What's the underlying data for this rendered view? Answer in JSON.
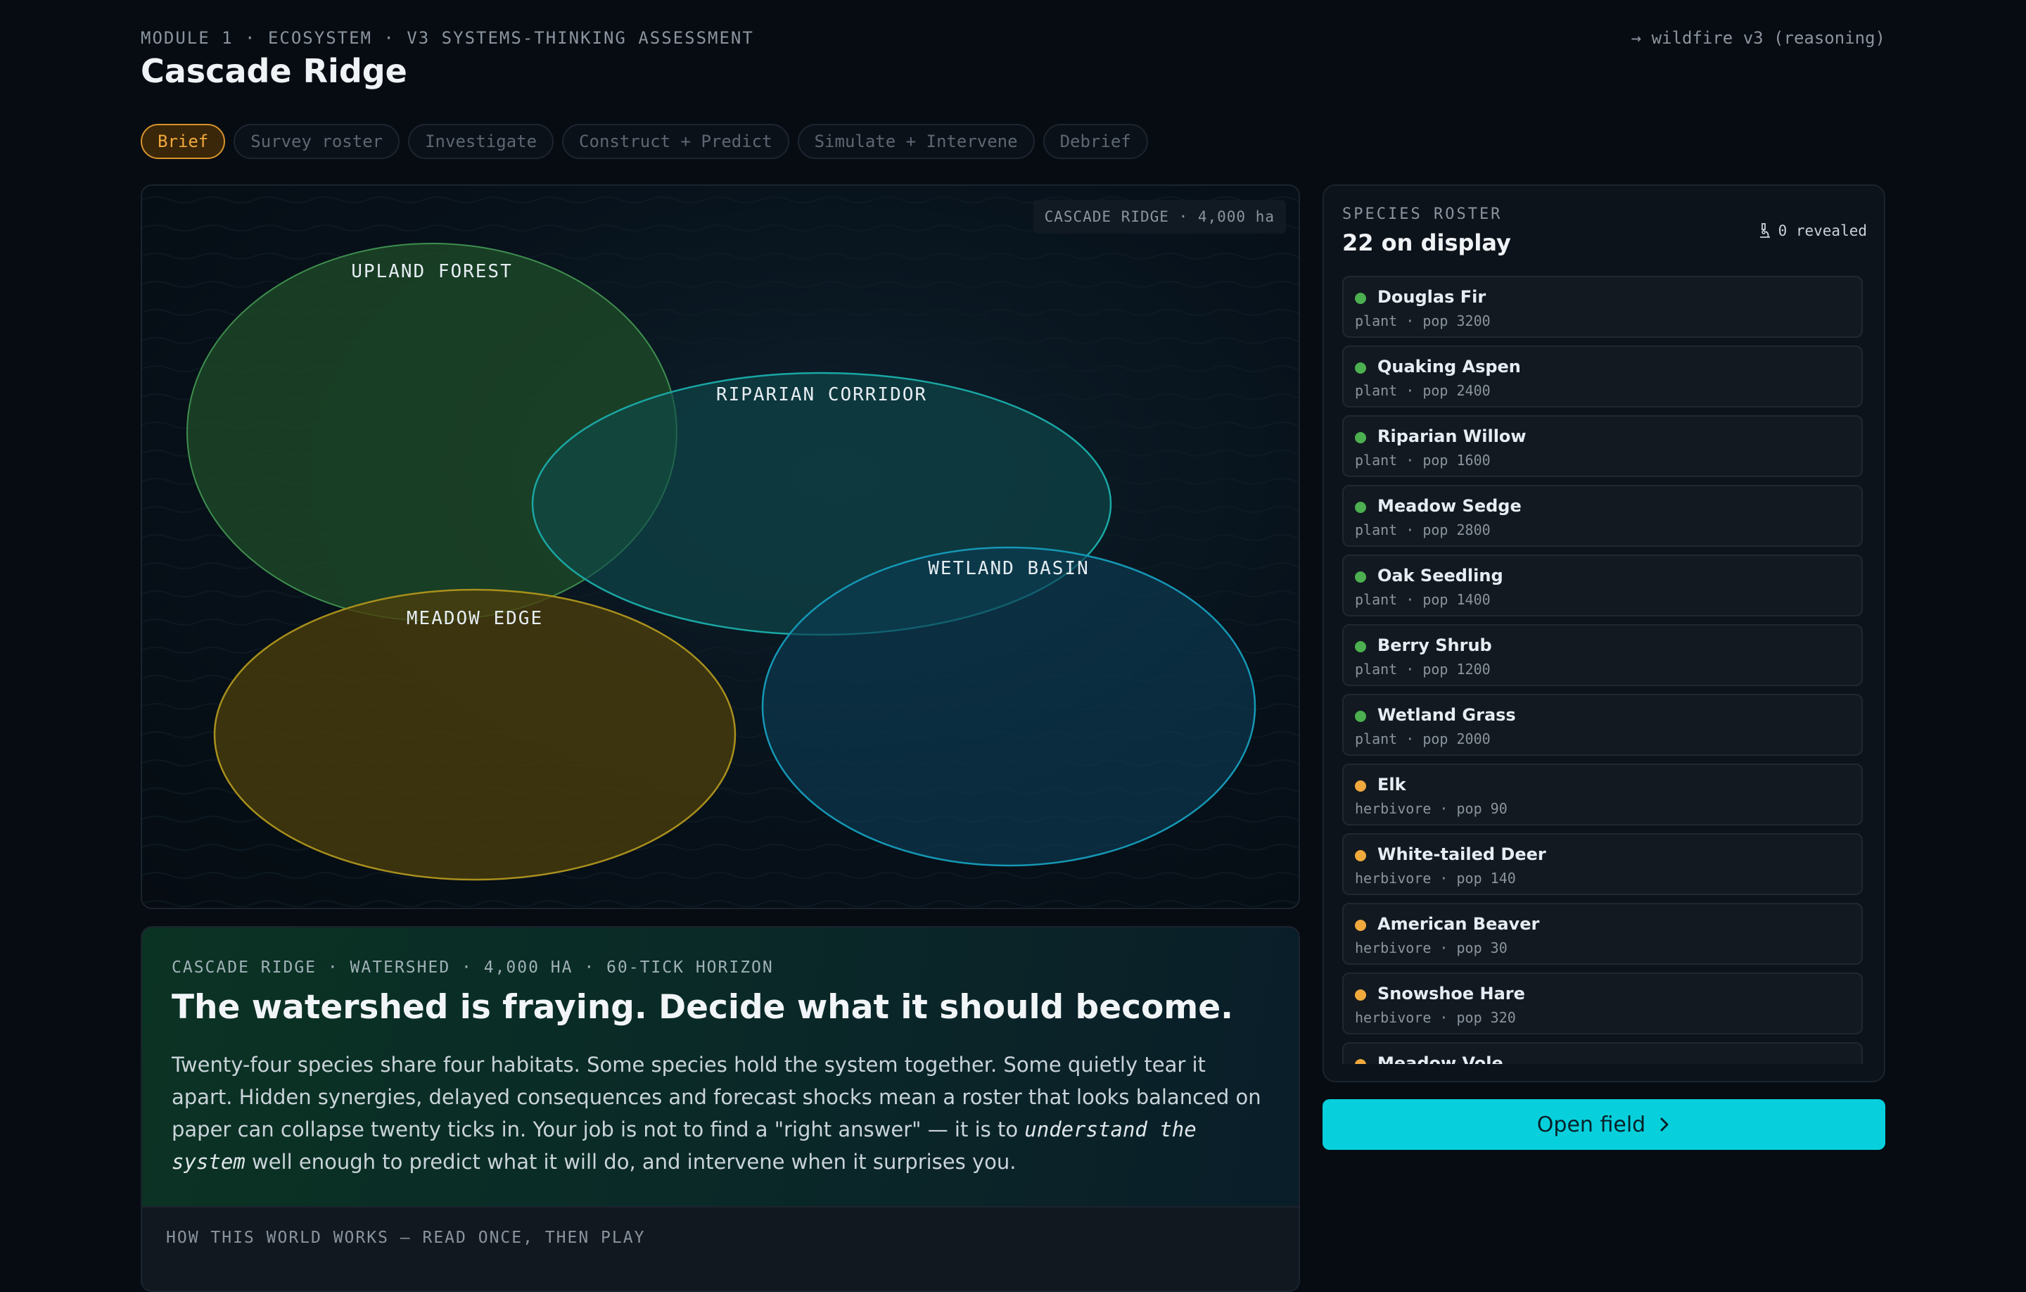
{
  "header": {
    "eyebrow": "MODULE 1 · ECOSYSTEM · V3 SYSTEMS-THINKING ASSESSMENT",
    "title": "Cascade Ridge",
    "mode": "→ wildfire v3 (reasoning)"
  },
  "tabs": [
    {
      "label": "Brief",
      "active": true
    },
    {
      "label": "Survey roster",
      "active": false
    },
    {
      "label": "Investigate",
      "active": false
    },
    {
      "label": "Construct + Predict",
      "active": false
    },
    {
      "label": "Simulate + Intervene",
      "active": false
    },
    {
      "label": "Debrief",
      "active": false
    }
  ],
  "map": {
    "badge": "CASCADE RIDGE · 4,000 ha",
    "habitats": [
      {
        "name": "UPLAND FOREST",
        "color": "#3f8f4f"
      },
      {
        "name": "RIPARIAN CORRIDOR",
        "color": "#1aa7a4"
      },
      {
        "name": "MEADOW EDGE",
        "color": "#a9901c"
      },
      {
        "name": "WETLAND BASIN",
        "color": "#1597b5"
      }
    ]
  },
  "brief": {
    "meta": "CASCADE RIDGE · WATERSHED · 4,000 HA · 60-TICK HORIZON",
    "headline": "The watershed is fraying. Decide what it should become.",
    "body_before": "Twenty-four species share four habitats. Some species hold the system together. Some quietly tear it apart. Hidden synergies, delayed consequences and forecast shocks mean a roster that looks balanced on paper can collapse twenty ticks in. Your job is not to find a \"right answer\" — it is to ",
    "body_emphasis": "understand the system",
    "body_after": " well enough to predict what it will do, and intervene when it surprises you.",
    "how_label": "HOW THIS WORLD WORKS — READ ONCE, THEN PLAY"
  },
  "roster": {
    "kicker": "SPECIES ROSTER",
    "count": "22 on display",
    "revealed": "0 revealed",
    "colors": {
      "plant": "#4caf50",
      "herbivore": "#f0a93d"
    },
    "species": [
      {
        "name": "Douglas Fir",
        "meta": "plant · pop 3200",
        "kind": "plant"
      },
      {
        "name": "Quaking Aspen",
        "meta": "plant · pop 2400",
        "kind": "plant"
      },
      {
        "name": "Riparian Willow",
        "meta": "plant · pop 1600",
        "kind": "plant"
      },
      {
        "name": "Meadow Sedge",
        "meta": "plant · pop 2800",
        "kind": "plant"
      },
      {
        "name": "Oak Seedling",
        "meta": "plant · pop 1400",
        "kind": "plant"
      },
      {
        "name": "Berry Shrub",
        "meta": "plant · pop 1200",
        "kind": "plant"
      },
      {
        "name": "Wetland Grass",
        "meta": "plant · pop 2000",
        "kind": "plant"
      },
      {
        "name": "Elk",
        "meta": "herbivore · pop 90",
        "kind": "herbivore"
      },
      {
        "name": "White-tailed Deer",
        "meta": "herbivore · pop 140",
        "kind": "herbivore"
      },
      {
        "name": "American Beaver",
        "meta": "herbivore · pop 30",
        "kind": "herbivore"
      },
      {
        "name": "Snowshoe Hare",
        "meta": "herbivore · pop 320",
        "kind": "herbivore"
      },
      {
        "name": "Meadow Vole",
        "meta": "",
        "kind": "herbivore"
      }
    ]
  },
  "action": {
    "open_label": "Open field"
  }
}
